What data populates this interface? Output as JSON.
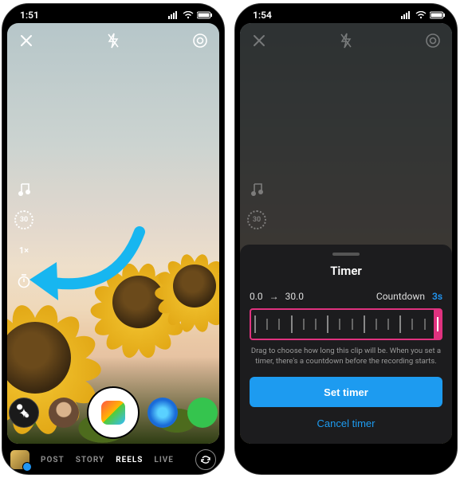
{
  "left": {
    "status_time": "1:51",
    "top": {
      "close": "✕",
      "flash": "⚡",
      "settings": "⚙"
    },
    "rail": {
      "audio": "♫",
      "length_badge": "30",
      "speed": "1×",
      "timer": "⏱"
    },
    "nav": {
      "items": [
        "POST",
        "STORY",
        "REELS",
        "LIVE"
      ],
      "active": "REELS"
    }
  },
  "right": {
    "status_time": "1:54",
    "sheet": {
      "title": "Timer",
      "range_start": "0.0",
      "range_arrow": "→",
      "range_end": "30.0",
      "countdown_label": "Countdown",
      "countdown_value": "3s",
      "hint": "Drag to choose how long this clip will be. When you set a timer, there's a countdown before the recording starts.",
      "set_label": "Set timer",
      "cancel_label": "Cancel timer"
    }
  }
}
